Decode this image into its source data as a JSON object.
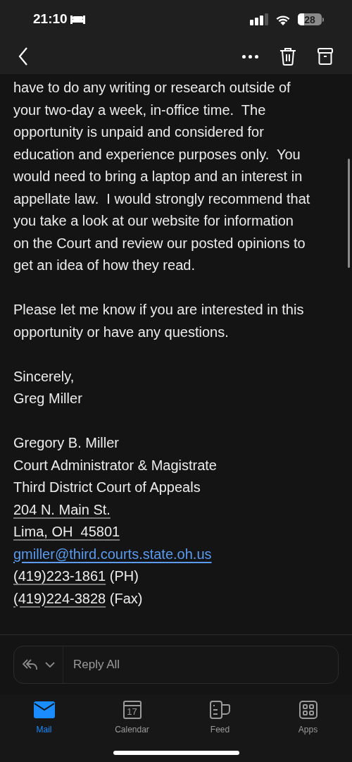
{
  "status_bar": {
    "time": "21:10",
    "battery": "28"
  },
  "body": {
    "paragraphs": [
      {
        "lines": [
          "have to do any writing or research outside of",
          "your two-day a week, in-office time.  The",
          "opportunity is unpaid and considered for",
          "education and experience purposes only.  You",
          "would need to bring a laptop and an interest in",
          "appellate law.  I would strongly recommend that",
          "you take a look at our website for information",
          "on the Court and review our posted opinions to",
          "get an idea of how they read."
        ]
      },
      {
        "lines": [
          "Please let me know if you are interested in this",
          "opportunity or have any questions."
        ]
      },
      {
        "lines": [
          "Sincerely,",
          "Greg Miller"
        ]
      }
    ],
    "signature": [
      {
        "kind": "text",
        "text": "Gregory B. Miller"
      },
      {
        "kind": "text",
        "text": "Court Administrator & Magistrate"
      },
      {
        "kind": "text",
        "text": "Third District Court of Appeals"
      },
      {
        "kind": "address",
        "text": "204 N. Main St."
      },
      {
        "kind": "address",
        "text": "Lima, OH  45801"
      },
      {
        "kind": "email",
        "text": "gmiller@third.courts.state.oh.us"
      },
      {
        "kind": "phone",
        "text": "(419)223-1861",
        "suffix": " (PH)"
      },
      {
        "kind": "phone",
        "text": "(419)224-3828",
        "suffix": " (Fax)"
      }
    ]
  },
  "reply": {
    "placeholder": "Reply All"
  },
  "tabs": [
    {
      "label": "Mail",
      "selected": true,
      "kind": "mail"
    },
    {
      "label": "Calendar",
      "selected": false,
      "kind": "calendar",
      "day": "17"
    },
    {
      "label": "Feed",
      "selected": false,
      "kind": "feed"
    },
    {
      "label": "Apps",
      "selected": false,
      "kind": "apps"
    }
  ]
}
